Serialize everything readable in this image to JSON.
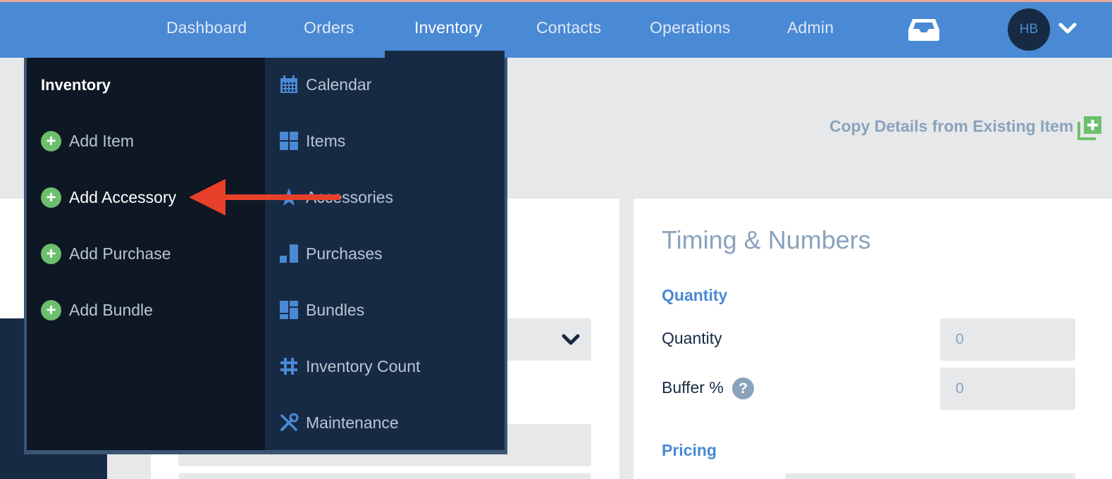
{
  "nav": {
    "items": [
      {
        "label": "Dashboard"
      },
      {
        "label": "Orders"
      },
      {
        "label": "Inventory"
      },
      {
        "label": "Contacts"
      },
      {
        "label": "Operations"
      },
      {
        "label": "Admin"
      }
    ],
    "active": "Inventory",
    "avatar_initials": "HB",
    "icons": {
      "tray": "inbox-tray-icon",
      "caret": "chevron-down-icon"
    }
  },
  "page": {
    "copy_link": "Copy Details from Existing Item",
    "section_title": "Timing & Numbers",
    "quantity_heading": "Quantity",
    "quantity_label": "Quantity",
    "quantity_value": "0",
    "buffer_label": "Buffer %",
    "buffer_value": "0",
    "help_symbol": "?",
    "pricing_heading": "Pricing"
  },
  "dropdown": {
    "header": "Inventory",
    "add_items": [
      {
        "label": "Add Item"
      },
      {
        "label": "Add Accessory",
        "highlighted": true
      },
      {
        "label": "Add Purchase"
      },
      {
        "label": "Add Bundle"
      }
    ],
    "links": [
      {
        "label": "Calendar",
        "icon": "calendar-icon"
      },
      {
        "label": "Items",
        "icon": "grid-icon"
      },
      {
        "label": "Accessories",
        "icon": "star-icon"
      },
      {
        "label": "Purchases",
        "icon": "bar-chart-icon"
      },
      {
        "label": "Bundles",
        "icon": "bundle-grid-icon"
      },
      {
        "label": "Inventory Count",
        "icon": "hash-icon"
      },
      {
        "label": "Maintenance",
        "icon": "tools-icon"
      }
    ]
  },
  "colors": {
    "nav_bg": "#4a89d4",
    "menu_dark": "#0e1724",
    "menu_navy": "#172a44",
    "accent_green": "#6cbf6c",
    "annotation_red": "#e8402a"
  }
}
